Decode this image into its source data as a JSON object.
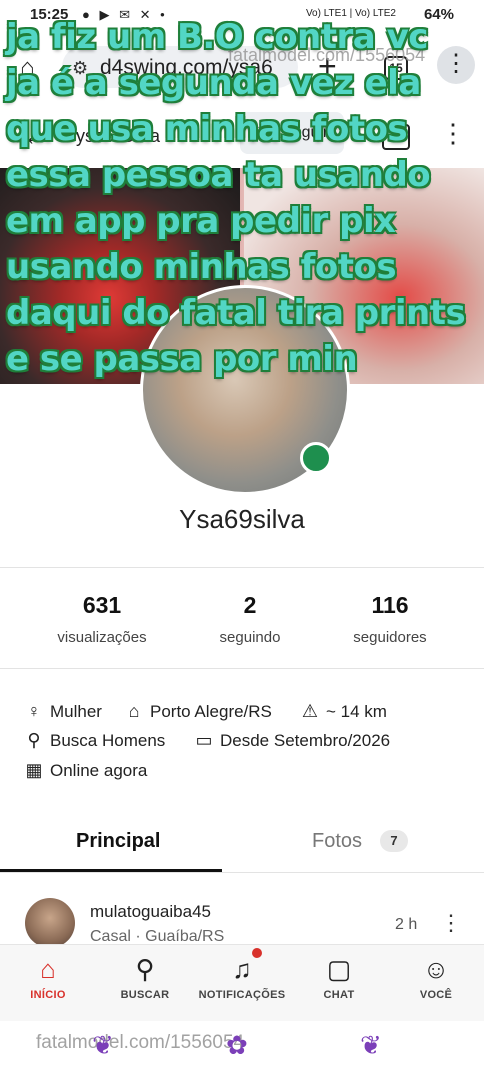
{
  "status_bar": {
    "time": "15:25",
    "battery": "64%",
    "network": "Vo) LTE1 | Vo) LTE2"
  },
  "browser": {
    "url": "d4swing.com/ysa6",
    "tab_count": "15"
  },
  "watermark": {
    "text": "fatalmodel.com/1556054"
  },
  "header": {
    "username": "ysa69silva",
    "follow_label": "Seguir"
  },
  "profile": {
    "name": "Ysa69silva",
    "stats": [
      {
        "value": "631",
        "label": "visualizações"
      },
      {
        "value": "2",
        "label": "seguindo"
      },
      {
        "value": "116",
        "label": "seguidores"
      }
    ],
    "info": {
      "gender": "Mulher",
      "city": "Porto Alegre/RS",
      "distance": "~ 14 km",
      "seeking": "Busca Homens",
      "since": "Desde Setembro/2026",
      "status": "Online agora"
    }
  },
  "tabs": {
    "main": "Principal",
    "photos": "Fotos",
    "photos_count": "7"
  },
  "post": {
    "user": "mulatoguaiba45",
    "location": "Casal · Guaíba/RS",
    "time": "2 h"
  },
  "bottom_nav": [
    {
      "label": "INÍCIO",
      "icon": "home-icon"
    },
    {
      "label": "BUSCAR",
      "icon": "search-icon"
    },
    {
      "label": "NOTIFICAÇÕES",
      "icon": "bell-icon"
    },
    {
      "label": "CHAT",
      "icon": "chat-icon"
    },
    {
      "label": "VOCÊ",
      "icon": "person-icon"
    }
  ],
  "overlay_text": [
    "ja fiz um B.O contra vc",
    "ja é a segunda vez  ela",
    "que usa minhas fotos",
    "essa pessoa ta usando",
    "em app pra pedir pix",
    "usando minhas fotos",
    "daqui do fatal tira prints",
    "e se passa por min"
  ],
  "colors": {
    "accent": "#d8312b",
    "overlay_fill": "#52d6c5",
    "overlay_outline": "#1f7f3a",
    "online": "#1e8f4e"
  }
}
